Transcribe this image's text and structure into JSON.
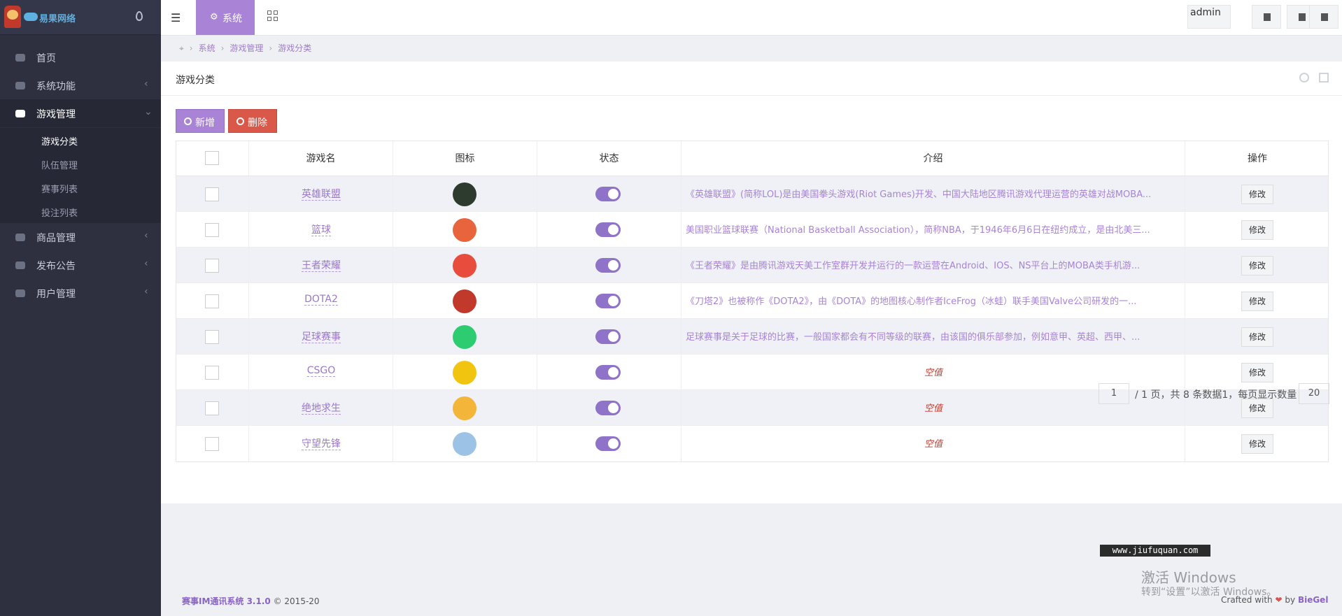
{
  "brand": {
    "text": "易果网络"
  },
  "sidebar": {
    "items": [
      {
        "label": "首页"
      },
      {
        "label": "系统功能"
      },
      {
        "label": "游戏管理"
      },
      {
        "label": "商品管理"
      },
      {
        "label": "发布公告"
      },
      {
        "label": "用户管理"
      }
    ],
    "sub_items": [
      {
        "label": "游戏分类"
      },
      {
        "label": "队伍管理"
      },
      {
        "label": "赛事列表"
      },
      {
        "label": "投注列表"
      }
    ]
  },
  "topbar": {
    "tab_label": "系统",
    "admin_label": "admin"
  },
  "breadcrumb": [
    "系统",
    "游戏管理",
    "游戏分类"
  ],
  "panel": {
    "title": "游戏分类"
  },
  "toolbar": {
    "add_label": "新增",
    "delete_label": "删除"
  },
  "table": {
    "headers": [
      "游戏名",
      "图标",
      "状态",
      "介绍",
      "操作"
    ],
    "edit_label": "修改",
    "empty_label": "空值",
    "rows": [
      {
        "name": "英雄联盟",
        "intro": "《英雄联盟》(简称LOL)是由美国拳头游戏(Riot Games)开发、中国大陆地区腾讯游戏代理运营的英雄对战MOBA...",
        "icon_color": "#2d3b2e"
      },
      {
        "name": "篮球",
        "intro": "美国职业篮球联赛（National Basketball Association），简称NBA，于1946年6月6日在纽约成立，是由北美三...",
        "icon_color": "#e8643c"
      },
      {
        "name": "王者荣耀",
        "intro": "《王者荣耀》是由腾讯游戏天美工作室群开发并运行的一款运营在Android、IOS、NS平台上的MOBA类手机游...",
        "icon_color": "#e74c3c"
      },
      {
        "name": "DOTA2",
        "intro": "《刀塔2》也被称作《DOTA2》，由《DOTA》的地图核心制作者IceFrog（冰蛙）联手美国Valve公司研发的一...",
        "icon_color": "#c0392b"
      },
      {
        "name": "足球赛事",
        "intro": "足球赛事是关于足球的比赛，一般国家都会有不同等级的联赛，由该国的俱乐部参加，例如意甲、英超、西甲、...",
        "icon_color": "#2ecc71"
      },
      {
        "name": "CSGO",
        "intro": "",
        "icon_color": "#f1c40f"
      },
      {
        "name": "绝地求生",
        "intro": "",
        "icon_color": "#f3b53a"
      },
      {
        "name": "守望先锋",
        "intro": "",
        "icon_color": "#9cc3e6"
      }
    ]
  },
  "pagination": {
    "current_page": "1",
    "text": "/ 1 页，共 8 条数据1，每页显示数量",
    "page_size": "20"
  },
  "footer": {
    "left_name": "赛事IM通讯系统 3.1.0",
    "left_suffix": "© 2015-20",
    "right_prefix": "Crafted with",
    "right_by": "by",
    "right_author": "BieGel"
  },
  "watermark": {
    "url": "www.jiufuquan.com",
    "activate": "激活 Windows",
    "activate_sub": "转到“设置”以激活 Windows。"
  }
}
